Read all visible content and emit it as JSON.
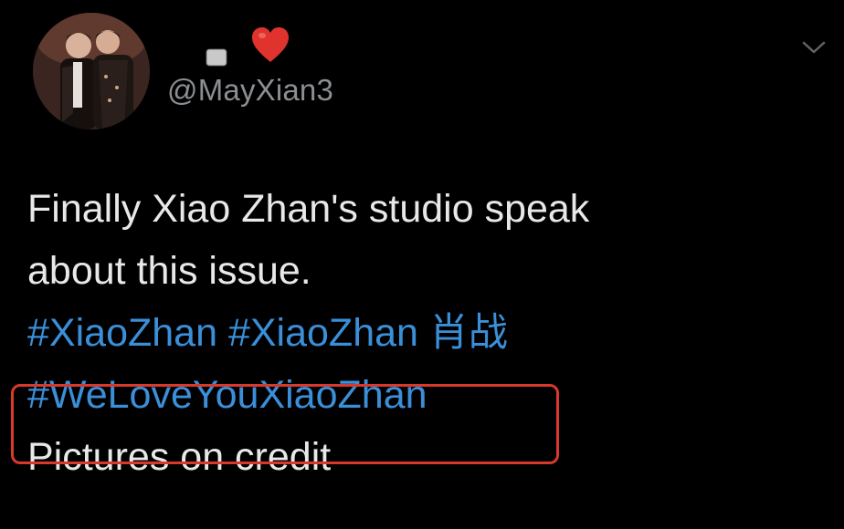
{
  "tweet": {
    "author": {
      "handle": "@MayXian3",
      "avatar": "avatar-photo",
      "display_name_icon": "heart-icon",
      "heart_color": "#e0332e"
    },
    "menu_icon": "chevron-down-icon",
    "text": {
      "line1": "Finally Xiao Zhan's studio speak",
      "line2": "about this issue.",
      "hashtag1": "#XiaoZhan",
      "hashtag2": "#XiaoZhan 肖战",
      "hashtag3": "#WeLoveYouXiaoZhan",
      "line5": "Pictures on credit"
    },
    "colors": {
      "background": "#000000",
      "text": "#e8e8e8",
      "handle": "#8b8f93",
      "hashtag": "#3a8fd8",
      "highlight_box": "#d9382c"
    }
  }
}
